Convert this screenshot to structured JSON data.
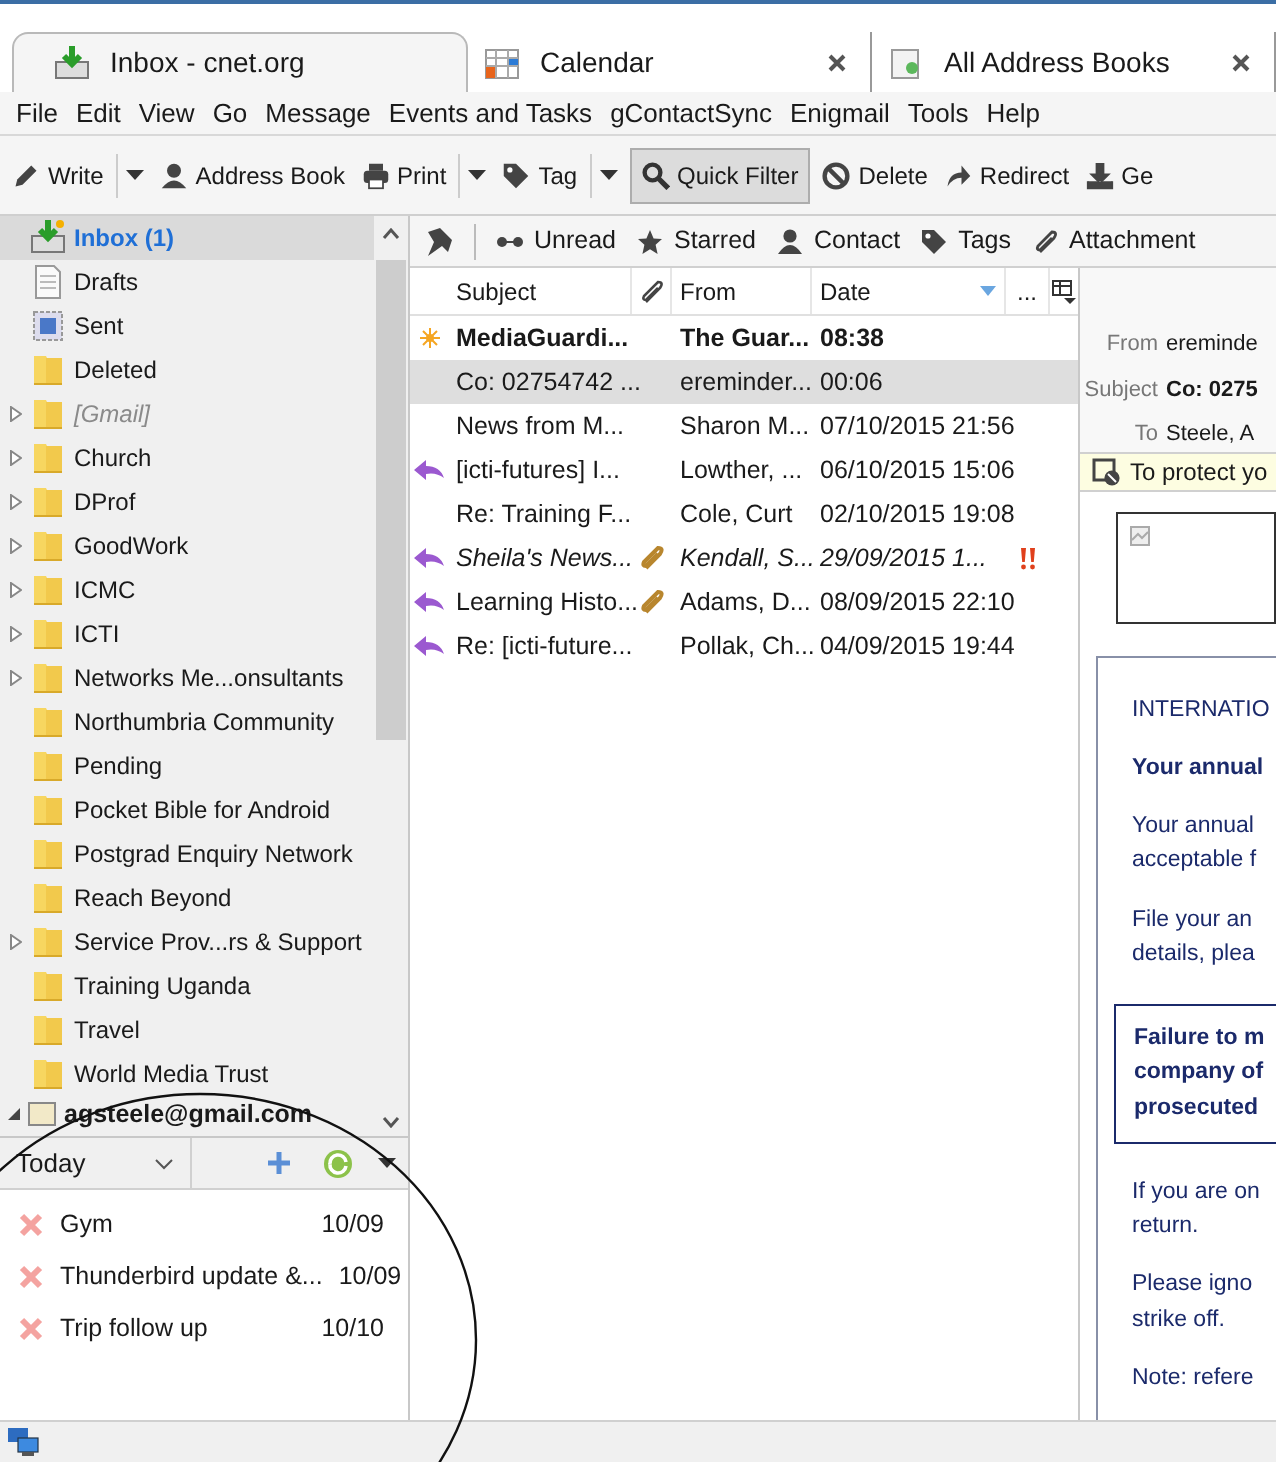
{
  "tabs": [
    {
      "label": "Inbox - cnet.org",
      "kind": "mail",
      "selected": true
    },
    {
      "label": "Calendar",
      "kind": "calendar",
      "selected": false
    },
    {
      "label": "All Address Books",
      "kind": "addressbook",
      "selected": false
    }
  ],
  "menu": [
    "File",
    "Edit",
    "View",
    "Go",
    "Message",
    "Events and Tasks",
    "gContactSync",
    "Enigmail",
    "Tools",
    "Help"
  ],
  "toolbar": [
    {
      "label": "Write",
      "kind": "write",
      "dropdown": true,
      "pressed": false
    },
    {
      "label": "Address Book",
      "kind": "addressbook",
      "dropdown": false,
      "pressed": false
    },
    {
      "label": "Print",
      "kind": "print",
      "dropdown": true,
      "pressed": false
    },
    {
      "label": "Tag",
      "kind": "tag",
      "dropdown": true,
      "pressed": false
    },
    {
      "label": "Quick Filter",
      "kind": "filter",
      "dropdown": false,
      "pressed": true
    },
    {
      "label": "Delete",
      "kind": "delete",
      "dropdown": false,
      "pressed": false
    },
    {
      "label": "Redirect",
      "kind": "redirect",
      "dropdown": false,
      "pressed": false
    },
    {
      "label": "Ge",
      "kind": "get",
      "dropdown": false,
      "pressed": false
    }
  ],
  "quick_filter": [
    {
      "label": "Unread",
      "kind": "unread"
    },
    {
      "label": "Starred",
      "kind": "starred"
    },
    {
      "label": "Contact",
      "kind": "contact"
    },
    {
      "label": "Tags",
      "kind": "tags"
    },
    {
      "label": "Attachment",
      "kind": "attachment"
    }
  ],
  "folders": [
    {
      "name": "Inbox (1)",
      "kind": "inbox",
      "selected": true,
      "expandable": false,
      "unread": true,
      "greyed": false
    },
    {
      "name": "Drafts",
      "kind": "drafts",
      "selected": false,
      "expandable": false,
      "unread": false,
      "greyed": false
    },
    {
      "name": "Sent",
      "kind": "sent",
      "selected": false,
      "expandable": false,
      "unread": false,
      "greyed": false
    },
    {
      "name": "Deleted",
      "kind": "folder",
      "selected": false,
      "expandable": false,
      "unread": false,
      "greyed": false
    },
    {
      "name": "[Gmail]",
      "kind": "folder",
      "selected": false,
      "expandable": true,
      "unread": false,
      "greyed": true
    },
    {
      "name": "Church",
      "kind": "folder",
      "selected": false,
      "expandable": true,
      "unread": false,
      "greyed": false
    },
    {
      "name": "DProf",
      "kind": "folder",
      "selected": false,
      "expandable": true,
      "unread": false,
      "greyed": false
    },
    {
      "name": "GoodWork",
      "kind": "folder",
      "selected": false,
      "expandable": true,
      "unread": false,
      "greyed": false
    },
    {
      "name": "ICMC",
      "kind": "folder",
      "selected": false,
      "expandable": true,
      "unread": false,
      "greyed": false
    },
    {
      "name": "ICTI",
      "kind": "folder",
      "selected": false,
      "expandable": true,
      "unread": false,
      "greyed": false
    },
    {
      "name": "Networks Me...onsultants",
      "kind": "folder",
      "selected": false,
      "expandable": true,
      "unread": false,
      "greyed": false
    },
    {
      "name": "Northumbria Community",
      "kind": "folder",
      "selected": false,
      "expandable": false,
      "unread": false,
      "greyed": false
    },
    {
      "name": "Pending",
      "kind": "folder",
      "selected": false,
      "expandable": false,
      "unread": false,
      "greyed": false
    },
    {
      "name": "Pocket Bible for Android",
      "kind": "folder",
      "selected": false,
      "expandable": false,
      "unread": false,
      "greyed": false
    },
    {
      "name": "Postgrad Enquiry Network",
      "kind": "folder",
      "selected": false,
      "expandable": false,
      "unread": false,
      "greyed": false
    },
    {
      "name": "Reach Beyond",
      "kind": "folder",
      "selected": false,
      "expandable": false,
      "unread": false,
      "greyed": false
    },
    {
      "name": "Service Prov...rs & Support",
      "kind": "folder",
      "selected": false,
      "expandable": true,
      "unread": false,
      "greyed": false
    },
    {
      "name": "Training Uganda",
      "kind": "folder",
      "selected": false,
      "expandable": false,
      "unread": false,
      "greyed": false
    },
    {
      "name": "Travel",
      "kind": "folder",
      "selected": false,
      "expandable": false,
      "unread": false,
      "greyed": false
    },
    {
      "name": "World Media Trust",
      "kind": "folder",
      "selected": false,
      "expandable": false,
      "unread": false,
      "greyed": false
    }
  ],
  "account": "agsteele@gmail.com",
  "messages": {
    "columns": [
      "Subject",
      "From",
      "Date",
      "..."
    ],
    "rows": [
      {
        "new": true,
        "replied": false,
        "subject": "MediaGuardi...",
        "attachment": false,
        "from": "The Guar...",
        "date": "08:38",
        "high_priority": false,
        "unread": true,
        "italic": false,
        "selected": false
      },
      {
        "new": false,
        "replied": false,
        "subject": "Co: 02754742 ...",
        "attachment": false,
        "from": "ereminder...",
        "date": "00:06",
        "high_priority": false,
        "unread": false,
        "italic": false,
        "selected": true
      },
      {
        "new": false,
        "replied": false,
        "subject": "News from M...",
        "attachment": false,
        "from": "Sharon M...",
        "date": "07/10/2015 21:56",
        "high_priority": false,
        "unread": false,
        "italic": false,
        "selected": false
      },
      {
        "new": false,
        "replied": true,
        "subject": "[icti-futures] I...",
        "attachment": false,
        "from": "Lowther, ...",
        "date": "06/10/2015 15:06",
        "high_priority": false,
        "unread": false,
        "italic": false,
        "selected": false
      },
      {
        "new": false,
        "replied": false,
        "subject": "Re: Training F...",
        "attachment": false,
        "from": "Cole, Curt",
        "date": "02/10/2015 19:08",
        "high_priority": false,
        "unread": false,
        "italic": false,
        "selected": false
      },
      {
        "new": false,
        "replied": true,
        "subject": "Sheila's News...",
        "attachment": true,
        "from": "Kendall, S...",
        "date": "29/09/2015 1...",
        "high_priority": true,
        "unread": false,
        "italic": true,
        "selected": false
      },
      {
        "new": false,
        "replied": true,
        "subject": "Learning Histo...",
        "attachment": true,
        "from": "Adams, D...",
        "date": "08/09/2015 22:10",
        "high_priority": false,
        "unread": false,
        "italic": false,
        "selected": false
      },
      {
        "new": false,
        "replied": true,
        "subject": "Re: [icti-future...",
        "attachment": false,
        "from": "Pollak, Ch...",
        "date": "04/09/2015 19:44",
        "high_priority": false,
        "unread": false,
        "italic": false,
        "selected": false
      }
    ]
  },
  "reader": {
    "fields": [
      {
        "label": "From",
        "value": "ereminde",
        "bold": false
      },
      {
        "label": "Subject",
        "value": "Co: 0275",
        "bold": true
      },
      {
        "label": "To",
        "value": "Steele, A",
        "bold": false
      }
    ],
    "notice": "To protect yo",
    "body": [
      {
        "kind": "plain",
        "lines": [
          "INTERNATIO"
        ]
      },
      {
        "kind": "bold",
        "lines": [
          "Your annual"
        ]
      },
      {
        "kind": "plain",
        "lines": [
          "Your annual",
          "acceptable f"
        ]
      },
      {
        "kind": "plain",
        "lines": [
          "File your an",
          "details, plea"
        ]
      },
      {
        "kind": "alert",
        "lines": [
          "Failure to m",
          "company of",
          "prosecuted"
        ]
      },
      {
        "kind": "plain",
        "lines": [
          "If you are on",
          "return."
        ]
      },
      {
        "kind": "plain",
        "lines": [
          "Please igno",
          "strike off."
        ]
      },
      {
        "kind": "plain",
        "lines": [
          "Note: refere"
        ]
      }
    ]
  },
  "tasks": {
    "filter": "Today",
    "items": [
      {
        "title": "Gym",
        "date": "10/09"
      },
      {
        "title": "Thunderbird update &...",
        "date": "10/09"
      },
      {
        "title": "Trip follow up",
        "date": "10/10"
      }
    ]
  }
}
